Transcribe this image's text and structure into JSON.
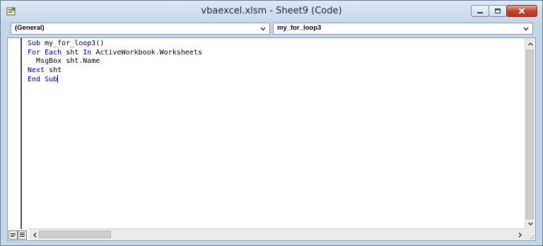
{
  "window": {
    "title": "vbaexcel.xlsm - Sheet9 (Code)"
  },
  "object_combo": {
    "value": "(General)"
  },
  "procedure_combo": {
    "value": "my_for_loop3"
  },
  "code_lines": [
    {
      "keyword": "Sub",
      "rest": " my_for_loop3()"
    },
    {
      "keyword": "For Each",
      "rest": " sht ",
      "keyword2": "In",
      "rest2": " ActiveWorkbook.Worksheets"
    },
    {
      "indent": "  ",
      "rest": "MsgBox sht.Name"
    },
    {
      "keyword": "Next",
      "rest": " sht"
    },
    {
      "keyword": "End Sub",
      "rest": ""
    }
  ],
  "colors": {
    "keyword": "#00008b",
    "close_button": "#c8442d"
  },
  "icons": {
    "app": "vba-code-icon",
    "minimize": "minimize-icon",
    "maximize": "maximize-icon",
    "close": "close-icon"
  }
}
